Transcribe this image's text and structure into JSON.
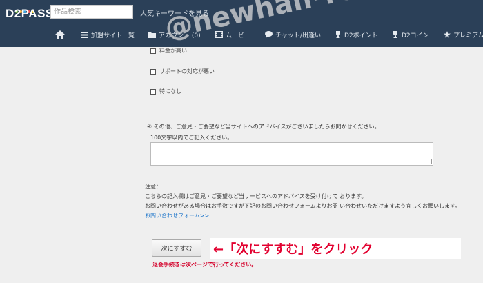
{
  "header": {
    "logo": "D2PASS",
    "logo_dot_colors": [
      "#7cc242",
      "#f5a623",
      "#3fa7e0",
      "#e94b4b",
      "#f5d223"
    ],
    "search_placeholder": "作品検索",
    "popular_link": "人気キーワードを見る",
    "bg_color": "#2b4058"
  },
  "nav": {
    "items": [
      {
        "icon": "home-icon",
        "label": ""
      },
      {
        "icon": "list-icon",
        "label": "加盟サイト一覧"
      },
      {
        "icon": "folder-icon",
        "label": "アカウント (0)"
      },
      {
        "icon": "film-icon",
        "label": "ムービー"
      },
      {
        "icon": "chat-icon",
        "label": "チャット/出逢い"
      },
      {
        "icon": "trophy-icon",
        "label": "D2ポイント"
      },
      {
        "icon": "trophy-icon",
        "label": "D2コイン"
      },
      {
        "icon": "star-icon",
        "label": "プレミアム"
      }
    ]
  },
  "form": {
    "checkboxes": [
      {
        "label": "料金が高い",
        "checked": false
      },
      {
        "label": "サポートの対応が悪い",
        "checked": false
      },
      {
        "label": "特になし",
        "checked": false
      }
    ],
    "question4": "④ その他、ご意見・ご要望など当サイトへのアドバイスがございましたらお聞かせください。",
    "question4_hint": "100文字以内でご記入ください。",
    "textarea_value": "",
    "note_title": "注意：",
    "note_lines": [
      "こちらの記入欄はご意見・ご要望など当サービスへのアドバイスを受け付けて おります。",
      "お問い合わせがある場合はお手数ですが下記のお問い合わせフォームよりお問 い合わせいただけますよう宜しくお願いします。"
    ],
    "contact_link": "お問い合わせフォーム>>",
    "next_button": "次にすすむ",
    "warning": "退会手続きは次ページで行ってください。"
  },
  "annotation": {
    "callout": "←「次にすすむ」をクリック",
    "callout_color": "#e2002f",
    "watermark": "@newhalf-review.info"
  }
}
